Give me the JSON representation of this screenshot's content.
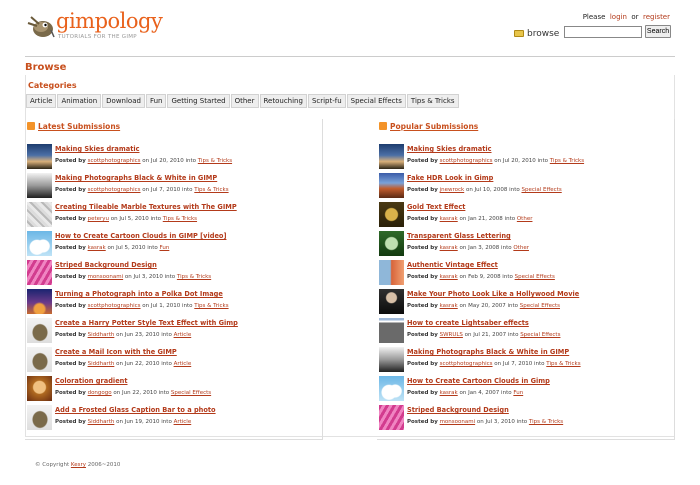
{
  "site": {
    "name": "gimpology",
    "tagline": "TUTORIALS FOR THE GIMP"
  },
  "userlinks": {
    "please": "Please",
    "login": "login",
    "or": "or",
    "register": "register"
  },
  "search": {
    "label": "browse",
    "button": "Search",
    "value": ""
  },
  "page": {
    "title": "Browse"
  },
  "categories": {
    "title": "Categories",
    "items": [
      "Article",
      "Animation",
      "Download",
      "Fun",
      "Getting Started",
      "Other",
      "Retouching",
      "Script-fu",
      "Special Effects",
      "Tips & Tricks"
    ]
  },
  "latest": {
    "title": "Latest Submissions",
    "items": [
      {
        "title": "Making Skies dramatic",
        "prefix": "Posted by",
        "author": "scottphotographics",
        "date": "on Jul 20, 2010 into",
        "category": "Tips & Tricks",
        "thumb": "sky"
      },
      {
        "title": "Making Photographs Black & White in GIMP",
        "prefix": "Posted by",
        "author": "scottphotographics",
        "date": "on Jul 7, 2010 into",
        "category": "Tips & Tricks",
        "thumb": "bw"
      },
      {
        "title": "Creating Tileable Marble Textures with The GIMP",
        "prefix": "Posted by",
        "author": "peteryu",
        "date": "on Jul 5, 2010 into",
        "category": "Tips & Tricks",
        "thumb": "marble"
      },
      {
        "title": "How to Create Cartoon Clouds in GIMP [video]",
        "prefix": "Posted by",
        "author": "kasrak",
        "date": "on Jul 5, 2010 into",
        "category": "Fun",
        "thumb": "cloud"
      },
      {
        "title": "Striped Background Design",
        "prefix": "Posted by",
        "author": "monsoonami",
        "date": "on Jul 3, 2010 into",
        "category": "Tips & Tricks",
        "thumb": "pink"
      },
      {
        "title": "Turning a Photograph into a Polka Dot Image",
        "prefix": "Posted by",
        "author": "scottphotographics",
        "date": "on Jul 1, 2010 into",
        "category": "Tips & Tricks",
        "thumb": "dusk"
      },
      {
        "title": "Create a Harry Potter Style Text Effect with Gimp",
        "prefix": "Posted by",
        "author": "Siddharth",
        "date": "on Jun 23, 2010 into",
        "category": "Article",
        "thumb": "wilber"
      },
      {
        "title": "Create a Mail Icon with the GIMP",
        "prefix": "Posted by",
        "author": "Siddharth",
        "date": "on Jun 22, 2010 into",
        "category": "Article",
        "thumb": "wilber"
      },
      {
        "title": "Coloration gradient",
        "prefix": "Posted by",
        "author": "dongogo",
        "date": "on Jun 22, 2010 into",
        "category": "Special Effects",
        "thumb": "portrait"
      },
      {
        "title": "Add a Frosted Glass Caption Bar to a photo",
        "prefix": "Posted by",
        "author": "Siddharth",
        "date": "on Jun 19, 2010 into",
        "category": "Article",
        "thumb": "wilber"
      }
    ]
  },
  "popular": {
    "title": "Popular Submissions",
    "items": [
      {
        "title": "Making Skies dramatic",
        "prefix": "Posted by",
        "author": "scottphotographics",
        "date": "on Jul 20, 2010 into",
        "category": "Tips & Tricks",
        "thumb": "sky"
      },
      {
        "title": "Fake HDR Look in Gimp",
        "prefix": "Posted by",
        "author": "jnewrock",
        "date": "on Jul 10, 2008 into",
        "category": "Special Effects",
        "thumb": "hdr"
      },
      {
        "title": "Gold Text Effect",
        "prefix": "Posted by",
        "author": "kasrak",
        "date": "on Jan 21, 2008 into",
        "category": "Other",
        "thumb": "gold"
      },
      {
        "title": "Transparent Glass Lettering",
        "prefix": "Posted by",
        "author": "kasrak",
        "date": "on Jan 3, 2008 into",
        "category": "Other",
        "thumb": "glass"
      },
      {
        "title": "Authentic Vintage Effect",
        "prefix": "Posted by",
        "author": "kasrak",
        "date": "on Feb 9, 2008 into",
        "category": "Special Effects",
        "thumb": "vintage"
      },
      {
        "title": "Make Your Photo Look Like a Hollywood Movie",
        "prefix": "Posted by",
        "author": "kasrak",
        "date": "on May 20, 2007 into",
        "category": "Special Effects",
        "thumb": "hollywood"
      },
      {
        "title": "How to create Lightsaber effects",
        "prefix": "Posted by",
        "author": "SWRULS",
        "date": "on Jul 21, 2007 into",
        "category": "Special Effects",
        "thumb": "saber"
      },
      {
        "title": "Making Photographs Black & White in GIMP",
        "prefix": "Posted by",
        "author": "scottphotographics",
        "date": "on Jul 7, 2010 into",
        "category": "Tips & Tricks",
        "thumb": "bw"
      },
      {
        "title": "How to Create Cartoon Clouds in Gimp",
        "prefix": "Posted by",
        "author": "kasrak",
        "date": "on Jan 4, 2007 into",
        "category": "Fun",
        "thumb": "cloud"
      },
      {
        "title": "Striped Background Design",
        "prefix": "Posted by",
        "author": "monsoonami",
        "date": "on Jul 3, 2010 into",
        "category": "Tips & Tricks",
        "thumb": "pink"
      }
    ]
  },
  "footer": {
    "prefix": "© Copyright",
    "link": "Kesry",
    "years": "2006~2010"
  },
  "colors": {
    "accent": "#c8501e",
    "link": "#b33a1a",
    "logo": "#e9611b"
  }
}
